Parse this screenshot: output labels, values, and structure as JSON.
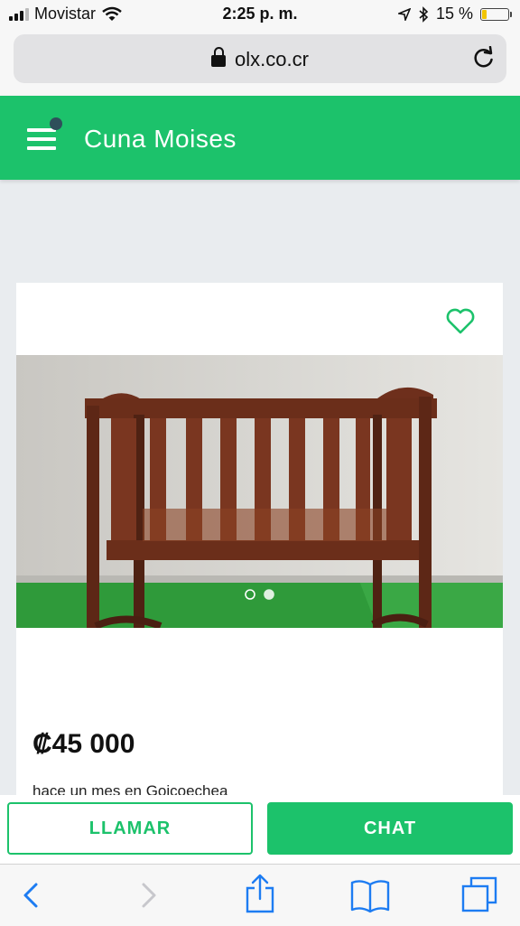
{
  "status_bar": {
    "carrier": "Movistar",
    "time": "2:25 p. m.",
    "battery": "15 %",
    "battery_level": 0.15
  },
  "browser": {
    "url": "olx.co.cr"
  },
  "header": {
    "title": "Cuna Moises"
  },
  "listing": {
    "price": "₡45 000",
    "meta": "hace un mes en Goicoechea",
    "image_count": 2,
    "active_image": 1
  },
  "actions": {
    "call_label": "LLAMAR",
    "chat_label": "CHAT"
  },
  "colors": {
    "brand_green": "#1cc26b",
    "ios_blue": "#1d7cf2"
  },
  "icons": [
    "signal-icon",
    "wifi-icon",
    "location-icon",
    "bluetooth-icon",
    "battery-icon",
    "lock-icon",
    "reload-icon",
    "menu-icon",
    "heart-icon",
    "back-icon",
    "forward-icon",
    "share-icon",
    "bookmarks-icon",
    "tabs-icon"
  ]
}
